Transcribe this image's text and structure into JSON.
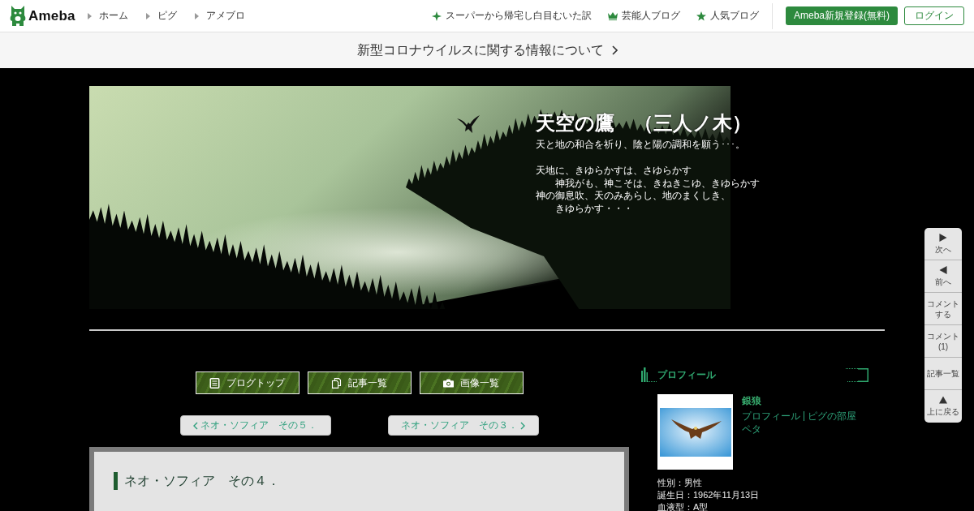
{
  "header": {
    "logo_text": "Ameba",
    "nav": [
      {
        "label": "ホーム"
      },
      {
        "label": "ピグ"
      },
      {
        "label": "アメブロ"
      }
    ],
    "links": [
      {
        "kind": "sparkle",
        "label": "スーパーから帰宅し白目むいた訳"
      },
      {
        "kind": "crown",
        "label": "芸能人ブログ"
      },
      {
        "kind": "star",
        "label": "人気ブログ"
      }
    ],
    "signup_button": "Ameba新規登録(無料)",
    "login_button": "ログイン"
  },
  "notice": {
    "text": "新型コロナウイルスに関する情報について"
  },
  "blog_header": {
    "title": "天空の鷹　（三人ノ木）",
    "tagline": "天と地の和合を祈り、陰と陽の調和を願う･･･。",
    "poem": [
      "天地に、きゆらかすは、さゆらかす",
      "　　神我がも、神こそは、きねきこゆ、きゆらかす",
      "神の御息吹、天のみあらし、地のまくしき、",
      "　　きゆらかす・・・"
    ]
  },
  "menu_buttons": [
    {
      "kind": "top",
      "label": "ブログトップ"
    },
    {
      "kind": "list",
      "label": "記事一覧"
    },
    {
      "kind": "images",
      "label": "画像一覧"
    }
  ],
  "pager": {
    "prev": "ネオ・ソフィア　その５．",
    "next": "ネオ・ソフィア　その３．"
  },
  "article": {
    "title": "ネオ・ソフィア　その４．"
  },
  "profile": {
    "heading": "プロフィール",
    "name": "銀狼",
    "links": [
      "プロフィール",
      "ピグの部屋"
    ],
    "peta": "ペタ",
    "details": [
      "性別：男性",
      "誕生日：1962年11月13日",
      "血液型：A型"
    ]
  },
  "side_nav": [
    {
      "kind": "next",
      "lines": [
        "次へ"
      ]
    },
    {
      "kind": "prev",
      "lines": [
        "前へ"
      ]
    },
    {
      "kind": "none",
      "lines": [
        "コメント",
        "する"
      ]
    },
    {
      "kind": "none",
      "lines": [
        "コメント",
        "(1)"
      ]
    },
    {
      "kind": "none",
      "lines": [
        "記事一覧"
      ]
    },
    {
      "kind": "up",
      "lines": [
        "上に戻る"
      ]
    }
  ]
}
